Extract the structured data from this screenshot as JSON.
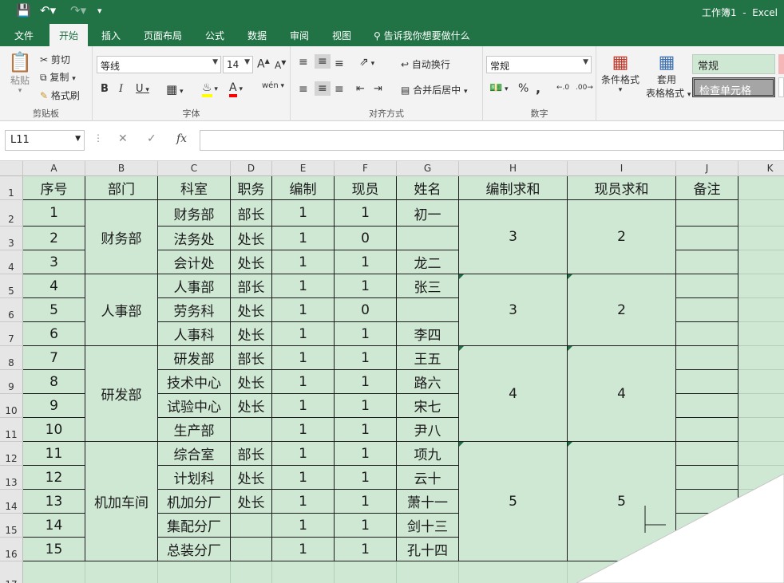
{
  "title": {
    "doc": "工作簿1",
    "sep": "-",
    "app": "Excel"
  },
  "tabs": [
    "文件",
    "开始",
    "插入",
    "页面布局",
    "公式",
    "数据",
    "审阅",
    "视图"
  ],
  "tell_me": "告诉我你想要做什么",
  "clipboard": {
    "paste": "粘贴",
    "cut": "剪切",
    "copy": "复制",
    "painter": "格式刷",
    "label": "剪贴板"
  },
  "font": {
    "name": "等线",
    "size": "14",
    "label": "字体",
    "bold": "B",
    "italic": "I",
    "underline": "U",
    "grow": "A",
    "shrink": "A",
    "phonetic": "wén"
  },
  "align": {
    "wrap": "自动换行",
    "merge": "合并后居中",
    "label": "对齐方式"
  },
  "number": {
    "format": "常规",
    "label": "数字",
    "percent": "%",
    "comma": ","
  },
  "styles": {
    "cond": "条件格式",
    "table_a": "套用",
    "table_b": "表格格式",
    "normal": "常规",
    "check": "检查单元格"
  },
  "formula_bar": {
    "name_box": "L11",
    "fx": "fx",
    "value": ""
  },
  "columns": [
    "A",
    "B",
    "C",
    "D",
    "E",
    "F",
    "G",
    "H",
    "I",
    "J",
    "K"
  ],
  "rows": [
    "1",
    "2",
    "3",
    "4",
    "5",
    "6",
    "7",
    "8",
    "9",
    "10",
    "11",
    "12",
    "13",
    "14",
    "15",
    "16",
    "17"
  ],
  "header": [
    "序号",
    "部门",
    "科室",
    "职务",
    "编制",
    "现员",
    "姓名",
    "编制求和",
    "现员求和",
    "备注"
  ],
  "data": [
    {
      "seq": "1",
      "office": "财务部",
      "post": "部长",
      "quota": "1",
      "staff": "1",
      "name": "初一"
    },
    {
      "seq": "2",
      "office": "法务处",
      "post": "处长",
      "quota": "1",
      "staff": "0",
      "name": ""
    },
    {
      "seq": "3",
      "office": "会计处",
      "post": "处长",
      "quota": "1",
      "staff": "1",
      "name": "龙二"
    },
    {
      "seq": "4",
      "office": "人事部",
      "post": "部长",
      "quota": "1",
      "staff": "1",
      "name": "张三"
    },
    {
      "seq": "5",
      "office": "劳务科",
      "post": "处长",
      "quota": "1",
      "staff": "0",
      "name": ""
    },
    {
      "seq": "6",
      "office": "人事科",
      "post": "处长",
      "quota": "1",
      "staff": "1",
      "name": "李四"
    },
    {
      "seq": "7",
      "office": "研发部",
      "post": "部长",
      "quota": "1",
      "staff": "1",
      "name": "王五"
    },
    {
      "seq": "8",
      "office": "技术中心",
      "post": "处长",
      "quota": "1",
      "staff": "1",
      "name": "路六"
    },
    {
      "seq": "9",
      "office": "试验中心",
      "post": "处长",
      "quota": "1",
      "staff": "1",
      "name": "宋七"
    },
    {
      "seq": "10",
      "office": "生产部",
      "post": "",
      "quota": "1",
      "staff": "1",
      "name": "尹八"
    },
    {
      "seq": "11",
      "office": "综合室",
      "post": "部长",
      "quota": "1",
      "staff": "1",
      "name": "项九"
    },
    {
      "seq": "12",
      "office": "计划科",
      "post": "处长",
      "quota": "1",
      "staff": "1",
      "name": "云十"
    },
    {
      "seq": "13",
      "office": "机加分厂",
      "post": "处长",
      "quota": "1",
      "staff": "1",
      "name": "萧十一"
    },
    {
      "seq": "14",
      "office": "集配分厂",
      "post": "",
      "quota": "1",
      "staff": "1",
      "name": "剑十三"
    },
    {
      "seq": "15",
      "office": "总装分厂",
      "post": "",
      "quota": "1",
      "staff": "1",
      "name": "孔十四"
    }
  ],
  "groups": [
    {
      "dept": "财务部",
      "quota_sum": "3",
      "staff_sum": "2",
      "start": 0,
      "count": 3
    },
    {
      "dept": "人事部",
      "quota_sum": "3",
      "staff_sum": "2",
      "start": 3,
      "count": 3
    },
    {
      "dept": "研发部",
      "quota_sum": "4",
      "staff_sum": "4",
      "start": 6,
      "count": 4
    },
    {
      "dept": "机加车间",
      "quota_sum": "5",
      "staff_sum": "5",
      "start": 10,
      "count": 5
    }
  ]
}
